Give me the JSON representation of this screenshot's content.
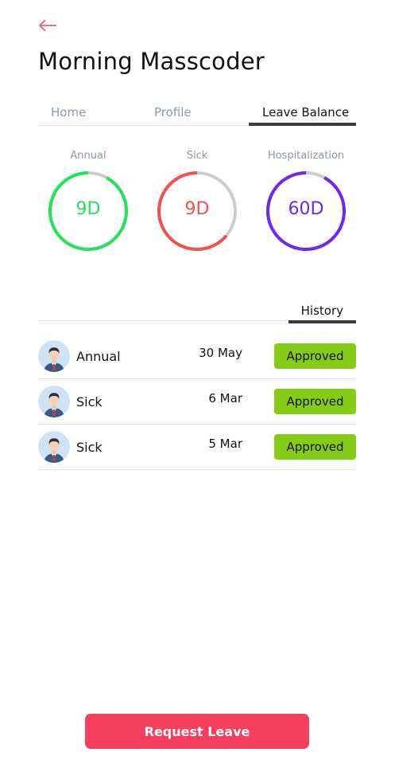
{
  "header": {
    "back_icon": "arrow-left-icon",
    "title": "Morning Masscoder",
    "accent_color": "#f43f5e"
  },
  "tabs": [
    {
      "label": "Home"
    },
    {
      "label": "Profile"
    },
    {
      "label": "Leave Balance",
      "active": true
    }
  ],
  "balances": [
    {
      "label": "Annual",
      "value": "9D",
      "color": "#22e35b",
      "fraction": 0.92
    },
    {
      "label": "Sick",
      "value": "9D",
      "color": "#ef5350",
      "fraction": 0.64
    },
    {
      "label": "Hospitalization",
      "value": "60D",
      "color": "#6a2af0",
      "fraction": 0.92
    }
  ],
  "history": {
    "title": "History",
    "items": [
      {
        "type": "Annual",
        "date": "30 May",
        "status": "Approved",
        "avatar": "person-avatar-icon"
      },
      {
        "type": "Sick",
        "date": "6 Mar",
        "status": "Approved",
        "avatar": "person-avatar-icon"
      },
      {
        "type": "Sick",
        "date": "5 Mar",
        "status": "Approved",
        "avatar": "person-avatar-icon"
      }
    ],
    "status_color": "#84cc16"
  },
  "actions": {
    "request_label": "Request Leave"
  }
}
